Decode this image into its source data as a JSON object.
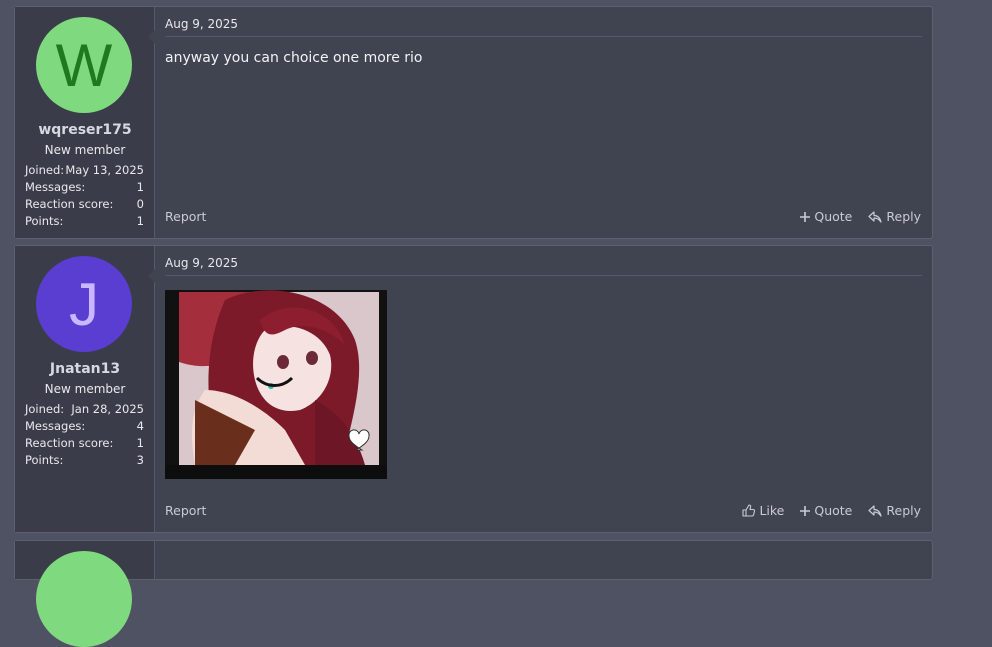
{
  "posts": [
    {
      "date": "Aug 9, 2025",
      "avatar_letter": "W",
      "avatar_bg": "#7fd97f",
      "avatar_fg": "#1f7a1f",
      "username": "wqreser175",
      "user_title": "New member",
      "stats": {
        "joined_label": "Joined:",
        "joined": "May 13, 2025",
        "messages_label": "Messages:",
        "messages": "1",
        "reaction_label": "Reaction score:",
        "reaction": "0",
        "points_label": "Points:",
        "points": "1"
      },
      "message": "anyway you can choice one more rio",
      "report": "Report",
      "quote": "Quote",
      "reply": "Reply"
    },
    {
      "date": "Aug 9, 2025",
      "avatar_letter": "J",
      "avatar_bg": "#5a3dd1",
      "avatar_fg": "#c9b8ff",
      "username": "Jnatan13",
      "user_title": "New member",
      "stats": {
        "joined_label": "Joined:",
        "joined": "Jan 28, 2025",
        "messages_label": "Messages:",
        "messages": "4",
        "reaction_label": "Reaction score:",
        "reaction": "1",
        "points_label": "Points:",
        "points": "3"
      },
      "attachment_icon": "anime-girl-image",
      "report": "Report",
      "like": "Like",
      "quote": "Quote",
      "reply": "Reply"
    },
    {
      "avatar_bg": "#7fd97f"
    }
  ]
}
